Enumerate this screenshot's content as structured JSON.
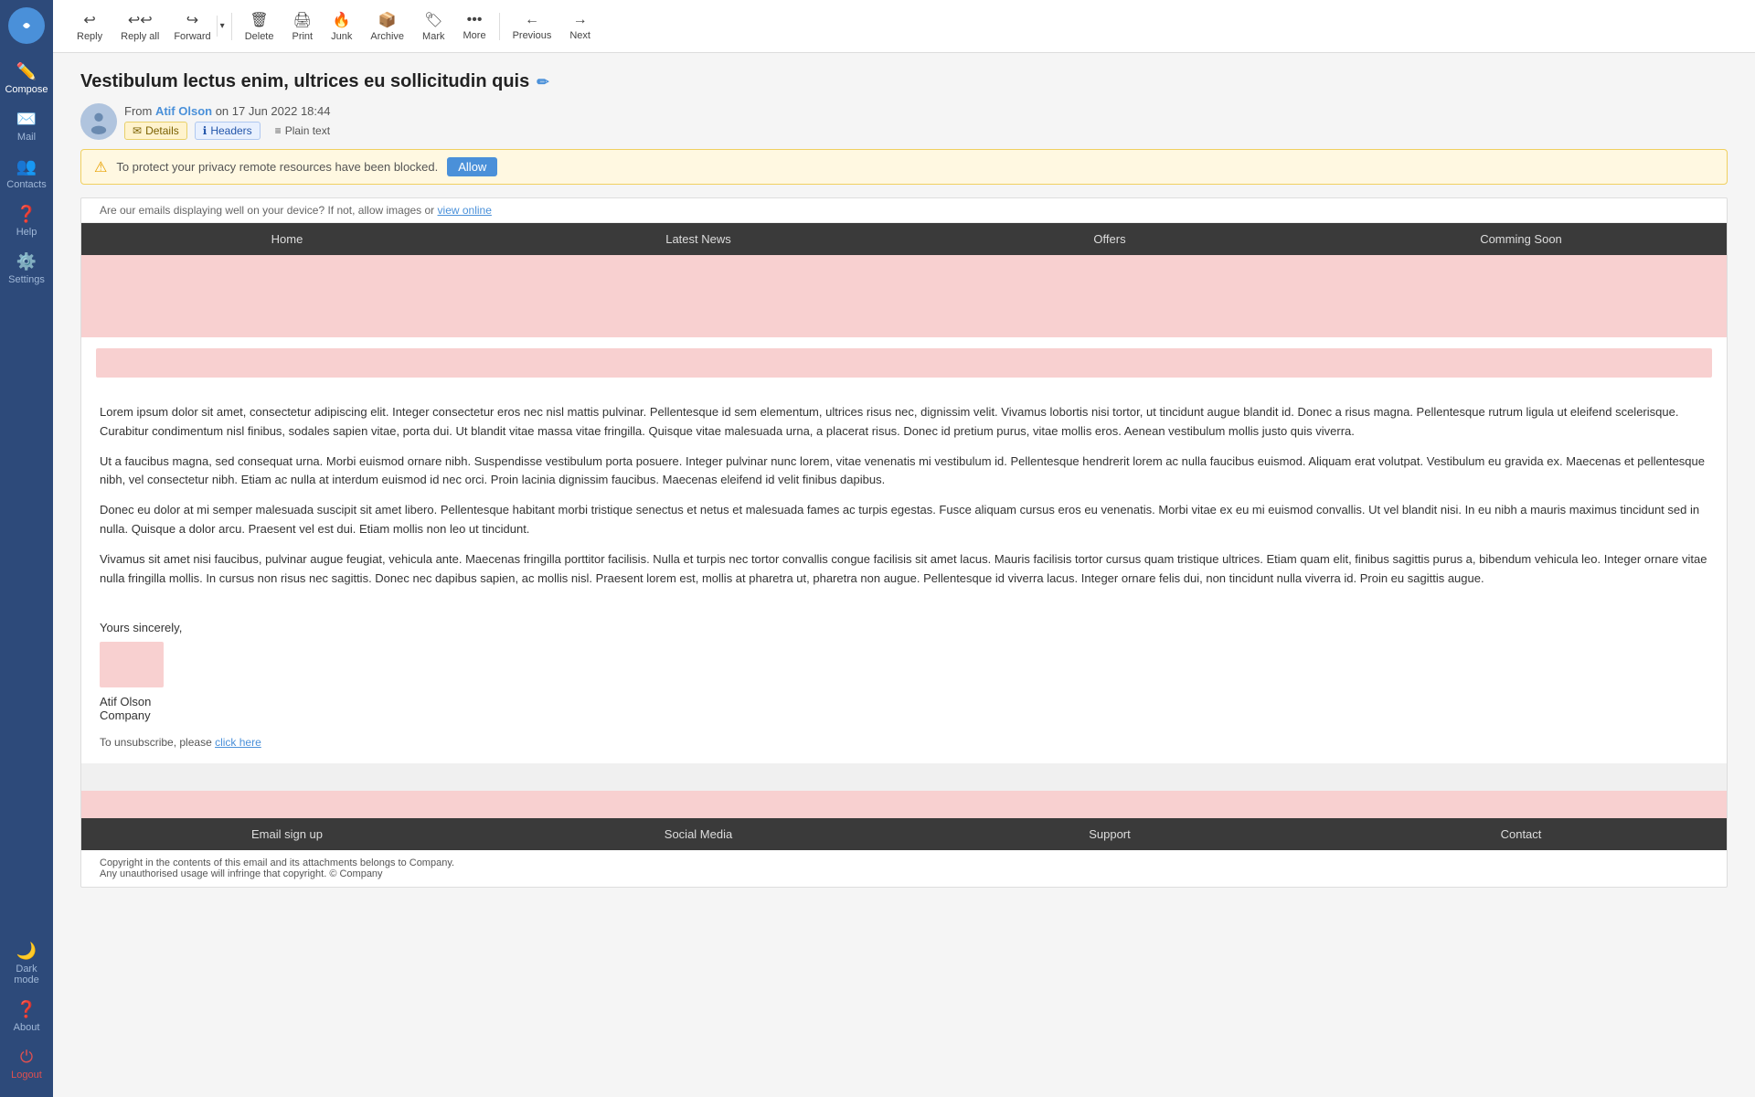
{
  "sidebar": {
    "logo_alt": "App logo",
    "items": [
      {
        "id": "compose",
        "label": "Compose",
        "icon": "✏️",
        "active": true
      },
      {
        "id": "mail",
        "label": "Mail",
        "icon": "✉️"
      },
      {
        "id": "contacts",
        "label": "Contacts",
        "icon": "👥"
      },
      {
        "id": "help",
        "label": "Help",
        "icon": "❓"
      },
      {
        "id": "settings",
        "label": "Settings",
        "icon": "⚙️"
      }
    ],
    "bottom": [
      {
        "id": "darkmode",
        "label": "Dark mode",
        "icon": "🌙"
      },
      {
        "id": "about",
        "label": "About",
        "icon": "❓"
      },
      {
        "id": "logout",
        "label": "Logout",
        "icon": "⏻"
      }
    ]
  },
  "toolbar": {
    "buttons": [
      {
        "id": "reply",
        "label": "Reply",
        "icon": "reply"
      },
      {
        "id": "reply-all",
        "label": "Reply all",
        "icon": "reply-all"
      },
      {
        "id": "forward",
        "label": "Forward",
        "icon": "forward"
      },
      {
        "id": "delete",
        "label": "Delete",
        "icon": "delete"
      },
      {
        "id": "print",
        "label": "Print",
        "icon": "print"
      },
      {
        "id": "junk",
        "label": "Junk",
        "icon": "junk"
      },
      {
        "id": "archive",
        "label": "Archive",
        "icon": "archive"
      },
      {
        "id": "mark",
        "label": "Mark",
        "icon": "mark"
      },
      {
        "id": "more",
        "label": "More",
        "icon": "more"
      },
      {
        "id": "previous",
        "label": "Previous",
        "icon": "previous"
      },
      {
        "id": "next",
        "label": "Next",
        "icon": "next"
      }
    ]
  },
  "email": {
    "subject": "Vestibulum lectus enim, ultrices eu sollicitudin quis",
    "from_label": "From",
    "sender_name": "Atif Olson",
    "date": "on 17 Jun 2022 18:44",
    "actions": {
      "details": "Details",
      "headers": "Headers",
      "plain_text": "Plain text"
    },
    "privacy_warning": "To protect your privacy remote resources have been blocked.",
    "allow_btn": "Allow",
    "top_note": "Are our emails displaying well on your device? If not, allow images or",
    "view_online": "view online",
    "nav_items": [
      "Home",
      "Latest News",
      "Offers",
      "Comming Soon"
    ],
    "body_paragraphs": [
      "Lorem ipsum dolor sit amet, consectetur adipiscing elit. Integer consectetur eros nec nisl mattis pulvinar. Pellentesque id sem elementum, ultrices risus nec, dignissim velit. Vivamus lobortis nisi tortor, ut tincidunt augue blandit id. Donec a risus magna. Pellentesque rutrum ligula ut eleifend scelerisque. Curabitur condimentum nisl finibus, sodales sapien vitae, porta dui. Ut blandit vitae massa vitae fringilla. Quisque vitae malesuada urna, a placerat risus. Donec id pretium purus, vitae mollis eros. Aenean vestibulum mollis justo quis viverra.",
      "Ut a faucibus magna, sed consequat urna. Morbi euismod ornare nibh. Suspendisse vestibulum porta posuere. Integer pulvinar nunc lorem, vitae venenatis mi vestibulum id. Pellentesque hendrerit lorem ac nulla faucibus euismod. Aliquam erat volutpat. Vestibulum eu gravida ex. Maecenas et pellentesque nibh, vel consectetur nibh. Etiam ac nulla at interdum euismod id nec orci. Proin lacinia dignissim faucibus. Maecenas eleifend id velit finibus dapibus.",
      "Donec eu dolor at mi semper malesuada suscipit sit amet libero. Pellentesque habitant morbi tristique senectus et netus et malesuada fames ac turpis egestas. Fusce aliquam cursus eros eu venenatis. Morbi vitae ex eu mi euismod convallis. Ut vel blandit nisi. In eu nibh a mauris maximus tincidunt sed in nulla. Quisque a dolor arcu. Praesent vel est dui. Etiam mollis non leo ut tincidunt.",
      "Vivamus sit amet nisi faucibus, pulvinar augue feugiat, vehicula ante. Maecenas fringilla porttitor facilisis. Nulla et turpis nec tortor convallis congue facilisis sit amet lacus. Mauris facilisis tortor cursus quam tristique ultrices. Etiam quam elit, finibus sagittis purus a, bibendum vehicula leo. Integer ornare vitae nulla fringilla mollis. In cursus non risus nec sagittis. Donec nec dapibus sapien, ac mollis nisl. Praesent lorem est, mollis at pharetra ut, pharetra non augue. Pellentesque id viverra lacus. Integer ornare felis dui, non tincidunt nulla viverra id. Proin eu sagittis augue."
    ],
    "sign_off": "Yours sincerely,",
    "sender_sig_name": "Atif Olson",
    "sender_sig_company": "Company",
    "unsubscribe_text": "To unsubscribe, please",
    "unsubscribe_link": "click here",
    "footer_nav_items": [
      "Email sign up",
      "Social Media",
      "Support",
      "Contact"
    ],
    "copyright_1": "Copyright in the contents of this email and its attachments belongs to Company.",
    "copyright_2": "Any unauthorised usage will infringe that copyright. © Company"
  }
}
